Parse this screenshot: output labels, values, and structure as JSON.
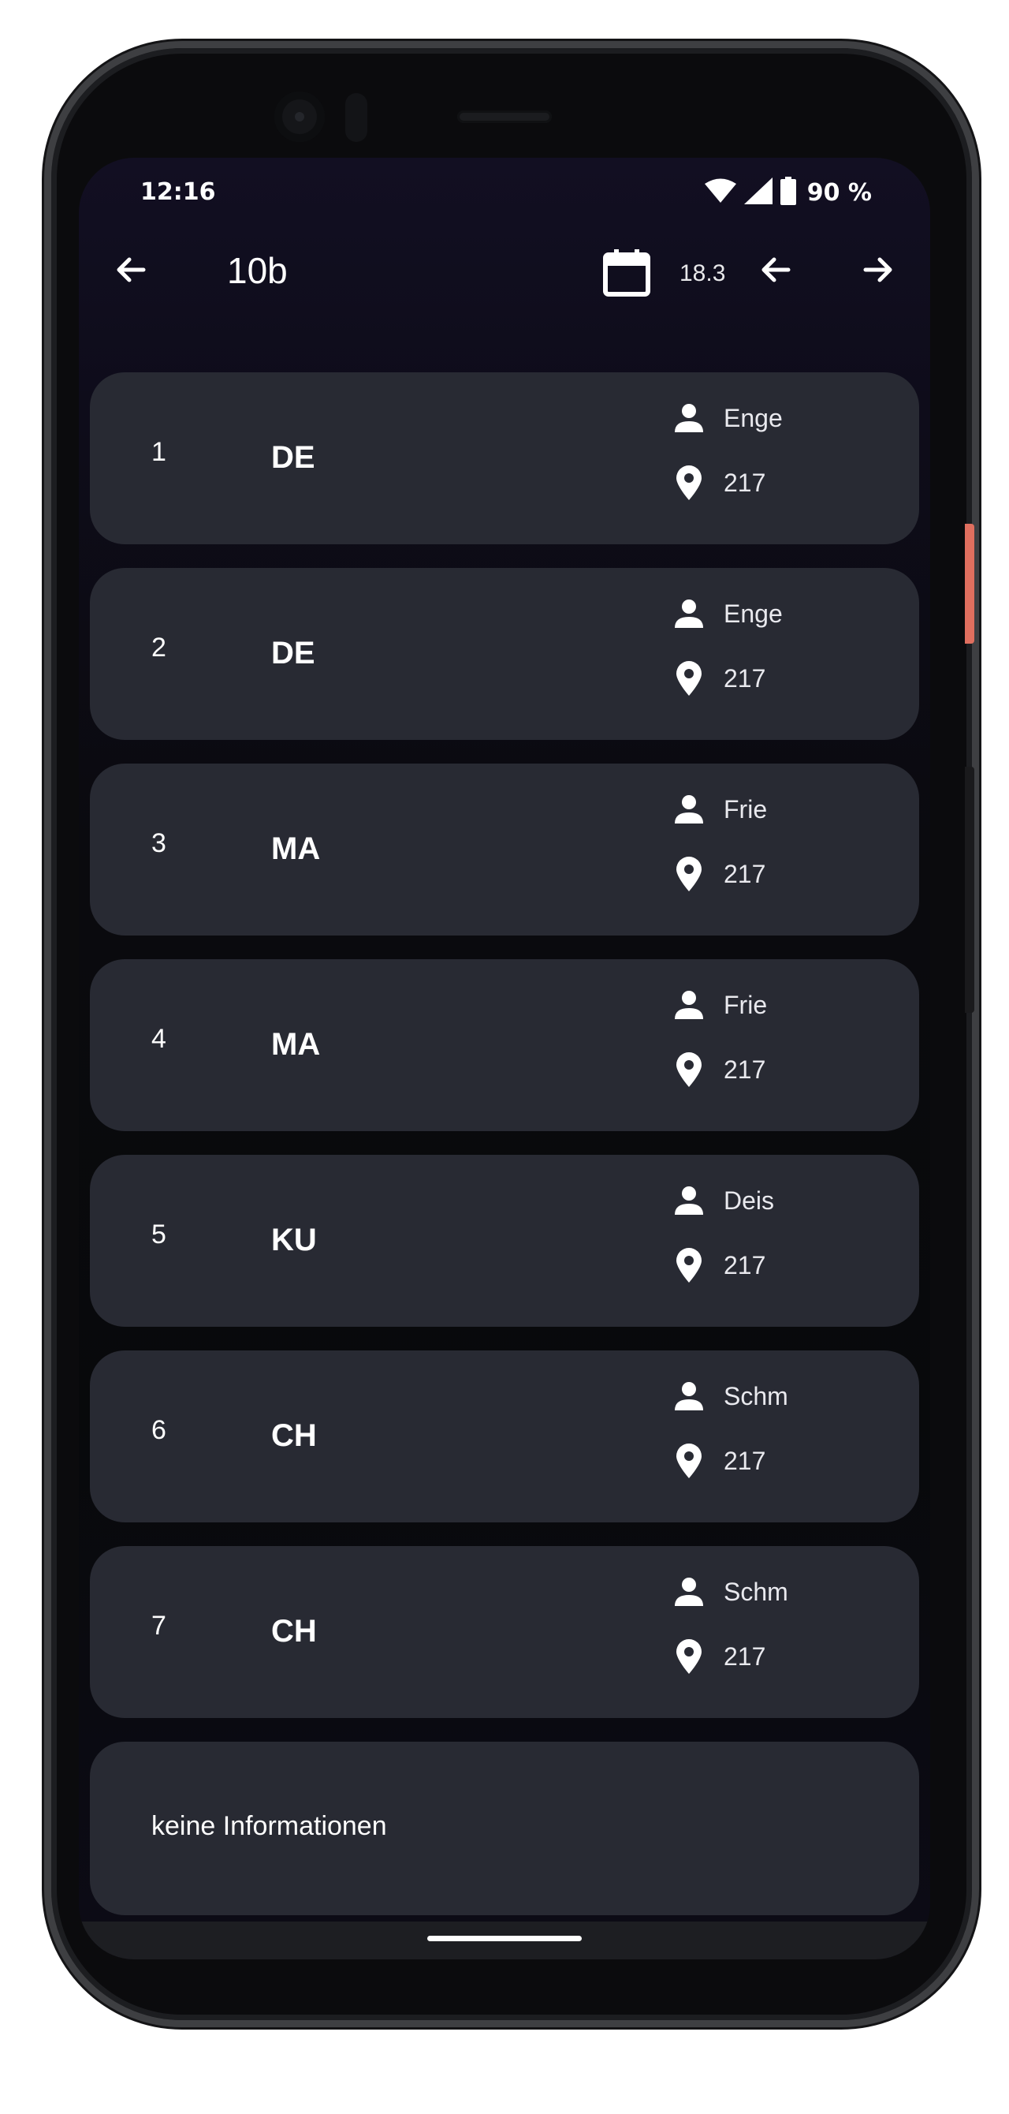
{
  "status_bar": {
    "time": "12:16",
    "battery": "90 %",
    "icons": [
      "wifi-icon",
      "signal-icon",
      "battery-icon"
    ]
  },
  "app_bar": {
    "title": "10b",
    "date": "18.3",
    "icons": [
      "back-arrow-icon",
      "calendar-icon",
      "previous-day-icon",
      "next-day-icon"
    ]
  },
  "lessons": [
    {
      "number": "1",
      "subject": "DE",
      "teacher": "Enge",
      "room": "217"
    },
    {
      "number": "2",
      "subject": "DE",
      "teacher": "Enge",
      "room": "217"
    },
    {
      "number": "3",
      "subject": "MA",
      "teacher": "Frie",
      "room": "217"
    },
    {
      "number": "4",
      "subject": "MA",
      "teacher": "Frie",
      "room": "217"
    },
    {
      "number": "5",
      "subject": "KU",
      "teacher": "Deis",
      "room": "217"
    },
    {
      "number": "6",
      "subject": "CH",
      "teacher": "Schm",
      "room": "217"
    },
    {
      "number": "7",
      "subject": "CH",
      "teacher": "Schm",
      "room": "217"
    }
  ],
  "info_card": {
    "text": "keine Informationen"
  },
  "colors": {
    "card_background": "#282a33",
    "screen_background": "#0a0a0e",
    "text": "#ffffff",
    "side_button_accent": "#e06f5f"
  }
}
